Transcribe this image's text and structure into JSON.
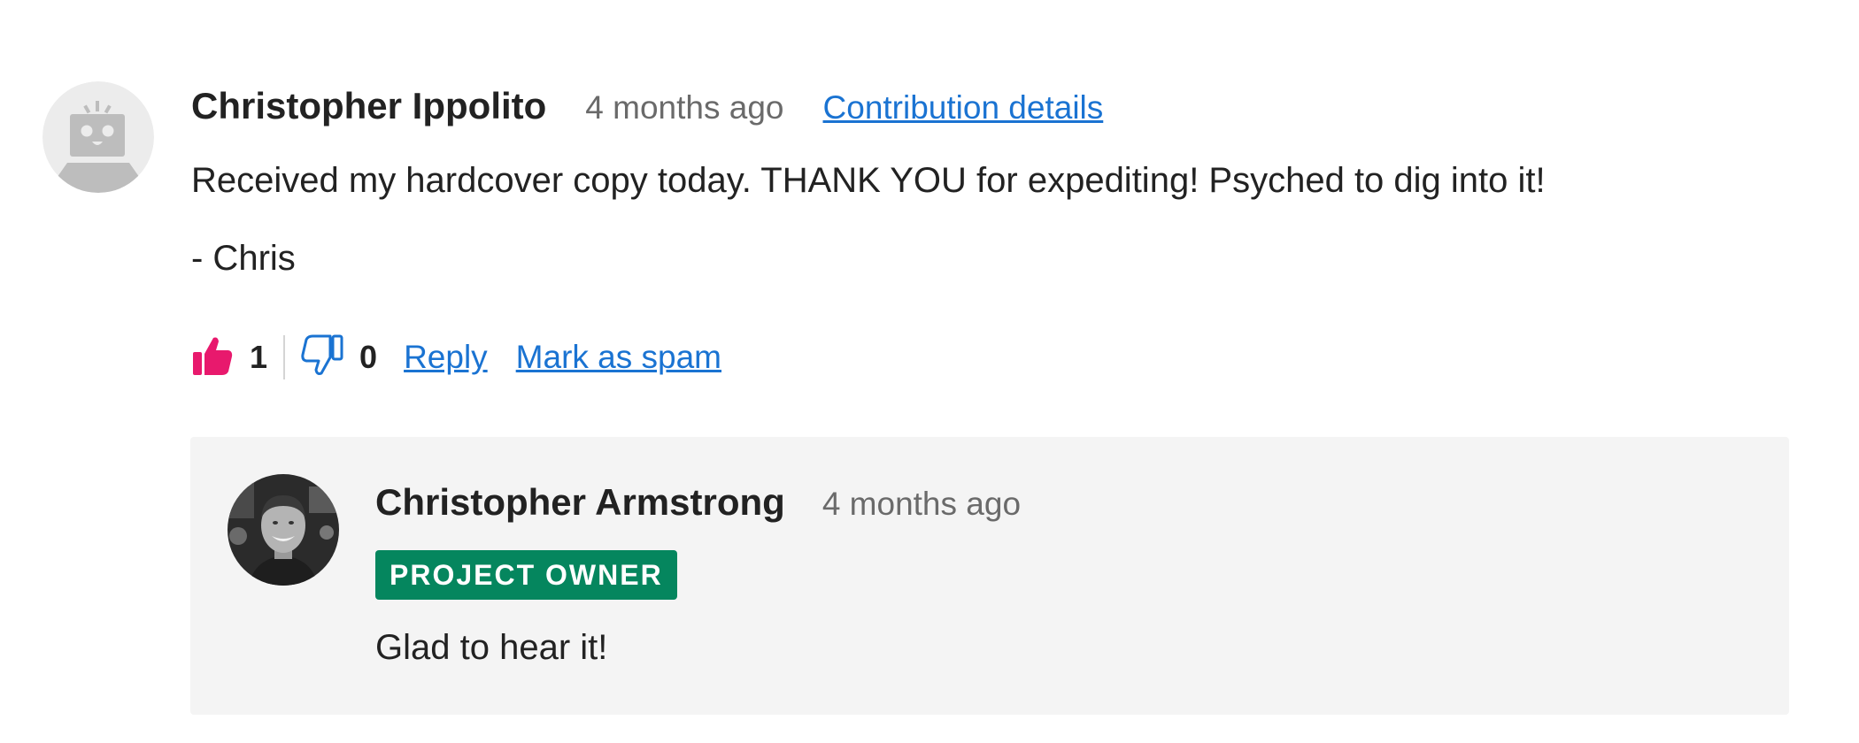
{
  "comment": {
    "author": "Christopher Ippolito",
    "time": "4 months ago",
    "details_link": "Contribution details",
    "text_line1": "Received my hardcover copy today. THANK YOU for expediting! Psyched to dig into it!",
    "text_line2": "- Chris",
    "likes": "1",
    "dislikes": "0",
    "reply_label": "Reply",
    "spam_label": "Mark as spam",
    "avatar_icon": "robot-avatar-icon",
    "like_icon": "thumbs-up-icon",
    "dislike_icon": "thumbs-down-icon"
  },
  "reply": {
    "author": "Christopher Armstrong",
    "time": "4 months ago",
    "badge": "PROJECT OWNER",
    "text": "Glad to hear it!",
    "avatar": "user-photo-avatar"
  },
  "colors": {
    "link": "#1a73d2",
    "like_active": "#e8196d",
    "badge_bg": "#05865e",
    "reply_bg": "#f4f4f4",
    "muted_text": "#6a6a6a"
  }
}
